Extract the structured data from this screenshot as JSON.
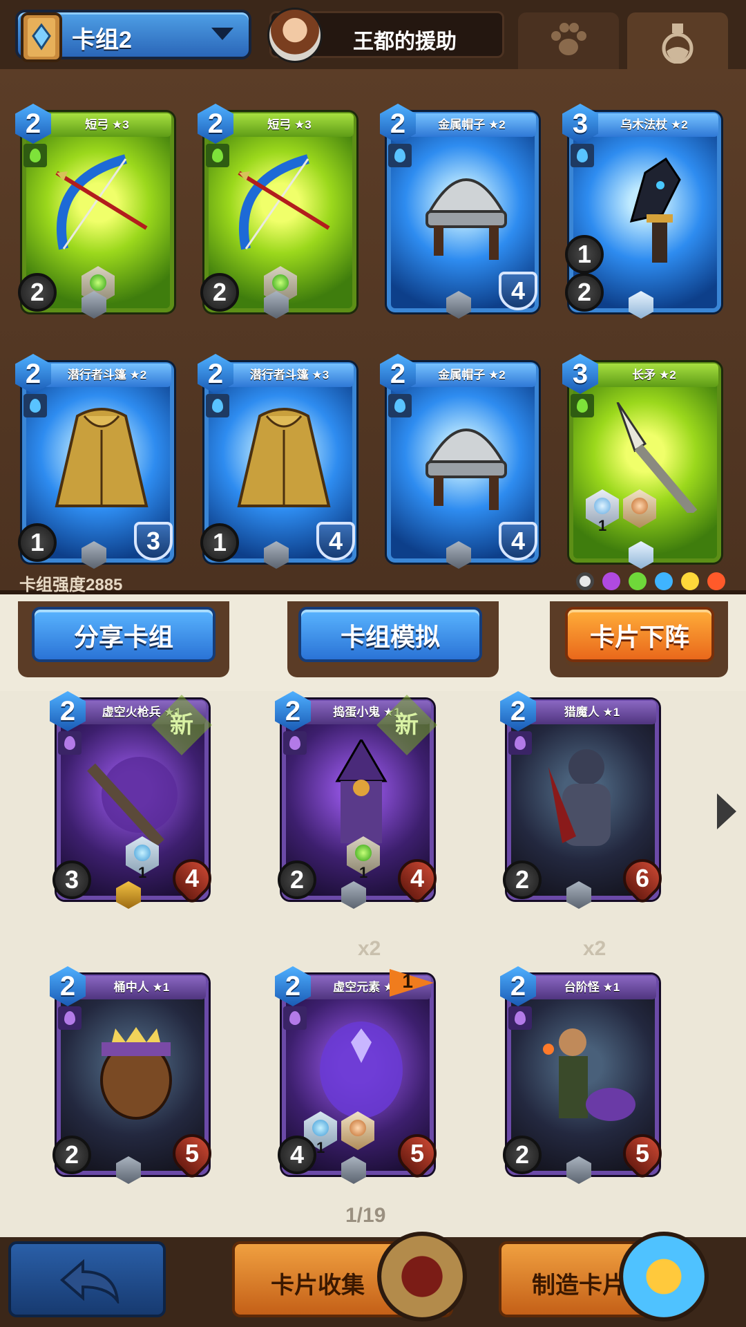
{
  "header": {
    "deck_name": "卡组2",
    "hero_name": "王都的援助"
  },
  "tabs": [
    {
      "icon": "paw-icon"
    },
    {
      "icon": "potion-icon"
    }
  ],
  "deck": {
    "power_label": "卡组强度2885",
    "cards": [
      {
        "name": "短弓 ★3",
        "cost": "2",
        "color": "green",
        "left_stat": "2",
        "left_icon": "bow-icon",
        "socket": "1",
        "item": "bow"
      },
      {
        "name": "短弓 ★3",
        "cost": "2",
        "color": "green",
        "left_stat": "2",
        "left_icon": "bow-icon",
        "socket": "1",
        "item": "bow"
      },
      {
        "name": "金属帽子 ★2",
        "cost": "2",
        "color": "blue",
        "shield": "4",
        "item": "helmet"
      },
      {
        "name": "乌木法杖 ★2",
        "cost": "3",
        "color": "blue",
        "left_stat": "2",
        "left_icon": "staff-icon",
        "mid_stat": "1",
        "item": "staff"
      },
      {
        "name": "潜行者斗篷 ★2",
        "cost": "2",
        "color": "blue",
        "left_stat": "1",
        "left_icon": "dice-icon",
        "shield": "3",
        "item": "cloak"
      },
      {
        "name": "潜行者斗篷 ★3",
        "cost": "2",
        "color": "blue",
        "left_stat": "1",
        "left_icon": "dice-icon",
        "shield": "4",
        "item": "cloak"
      },
      {
        "name": "金属帽子 ★2",
        "cost": "2",
        "color": "blue",
        "shield": "4",
        "item": "helmet"
      },
      {
        "name": "长矛 ★2",
        "cost": "3",
        "color": "green",
        "socket": "1",
        "item": "spear"
      }
    ]
  },
  "filters": [
    {
      "icon": "neutral-element-icon",
      "color": "#e8e8e8"
    },
    {
      "icon": "shadow-element-icon",
      "color": "#b04ae0"
    },
    {
      "icon": "nature-element-icon",
      "color": "#6fd83a"
    },
    {
      "icon": "water-element-icon",
      "color": "#3fb4ff"
    },
    {
      "icon": "lightning-element-icon",
      "color": "#ffd83a"
    },
    {
      "icon": "fire-element-icon",
      "color": "#ff5a2a"
    }
  ],
  "actions": {
    "share": "分享卡组",
    "simulate": "卡组模拟",
    "remove": "卡片下阵"
  },
  "collection": {
    "page": "1/19",
    "new_label": "新",
    "cards": [
      {
        "name": "虚空火枪兵 ★1",
        "cost": "2",
        "left_stat": "3",
        "hp": "4",
        "socket": "1",
        "new": true,
        "gold": true,
        "copies": ""
      },
      {
        "name": "捣蛋小鬼 ★1",
        "cost": "2",
        "left_stat": "2",
        "hp": "4",
        "socket": "1",
        "new": true,
        "gold": false,
        "copies": ""
      },
      {
        "name": "猎魔人 ★1",
        "cost": "2",
        "left_stat": "2",
        "hp": "6",
        "socket": "",
        "new": false,
        "gold": false,
        "copies": ""
      },
      {
        "name": "桶中人 ★1",
        "cost": "2",
        "left_stat": "2",
        "hp": "5",
        "socket": "",
        "new": false,
        "gold": false,
        "copies": ""
      },
      {
        "name": "虚空元素 ★6",
        "cost": "2",
        "left_stat": "4",
        "hp": "5",
        "socket": "1",
        "new": false,
        "gold": false,
        "copies": "x2",
        "flag": "1"
      },
      {
        "name": "台阶怪 ★1",
        "cost": "2",
        "left_stat": "2",
        "hp": "5",
        "socket": "",
        "new": false,
        "gold": false,
        "copies": "x2"
      }
    ]
  },
  "bottom": {
    "collect": "卡片收集",
    "craft": "制造卡片"
  }
}
